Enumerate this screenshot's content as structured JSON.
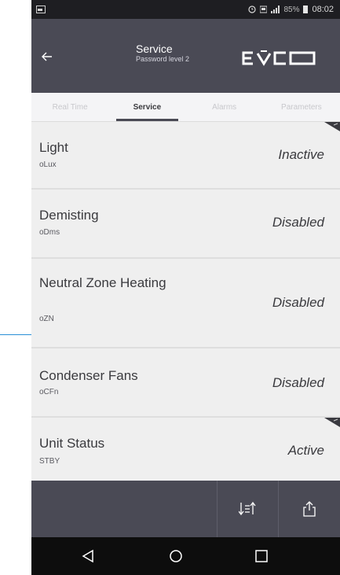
{
  "status_bar": {
    "battery_percent": "85%",
    "time": "08:02"
  },
  "header": {
    "title": "Service",
    "subtitle": "Password level 2",
    "brand_icon": "evco-logo"
  },
  "tabs": [
    {
      "label": "Real Time",
      "active": false
    },
    {
      "label": "Service",
      "active": true
    },
    {
      "label": "Alarms",
      "active": false
    },
    {
      "label": "Parameters",
      "active": false
    }
  ],
  "rows": [
    {
      "name": "Light",
      "code": "oLux",
      "value": "Inactive"
    },
    {
      "name": "Demisting",
      "code": "oDms",
      "value": "Disabled"
    },
    {
      "name": "Neutral Zone Heating",
      "code": "oZN",
      "value": "Disabled"
    },
    {
      "name": "Condenser Fans",
      "code": "oCFn",
      "value": "Disabled"
    },
    {
      "name": "Unit Status",
      "code": "STBY",
      "value": "Active"
    }
  ],
  "toolbar": {
    "sort_icon": "sort-icon",
    "share_icon": "share-icon"
  },
  "navbar": {
    "back_icon": "nav-back-icon",
    "home_icon": "nav-home-icon",
    "recents_icon": "nav-recents-icon"
  },
  "colors": {
    "header_bg": "#4a4a55",
    "row_bg": "#efefef",
    "accent_line": "#2a8fd6"
  }
}
